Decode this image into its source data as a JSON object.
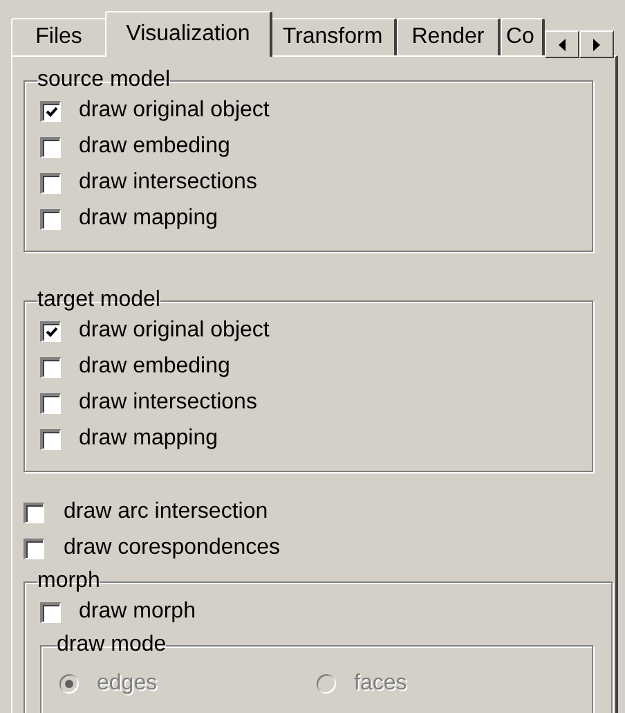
{
  "tabs": [
    {
      "label": "Files",
      "selected": false
    },
    {
      "label": "Visualization",
      "selected": true
    },
    {
      "label": "Transform",
      "selected": false
    },
    {
      "label": "Render",
      "selected": false
    },
    {
      "label": "Co",
      "selected": false
    }
  ],
  "groups": [
    {
      "title": "source model",
      "items": [
        {
          "label": "draw original object",
          "checked": true
        },
        {
          "label": "draw embeding",
          "checked": false
        },
        {
          "label": "draw intersections",
          "checked": false
        },
        {
          "label": "draw mapping",
          "checked": false
        }
      ]
    },
    {
      "title": "target model",
      "items": [
        {
          "label": "draw original object",
          "checked": true
        },
        {
          "label": "draw embeding",
          "checked": false
        },
        {
          "label": "draw intersections",
          "checked": false
        },
        {
          "label": "draw mapping",
          "checked": false
        }
      ]
    }
  ],
  "options": [
    {
      "label": "draw arc intersection",
      "checked": false
    },
    {
      "label": "draw corespondences",
      "checked": false
    }
  ],
  "morph": {
    "title": "morph",
    "draw_morph": {
      "label": "draw morph",
      "checked": false
    },
    "draw_mode": {
      "title": "draw mode",
      "options": [
        {
          "label": "edges",
          "selected": true,
          "disabled": true
        },
        {
          "label": "faces",
          "selected": false,
          "disabled": true
        }
      ]
    }
  }
}
